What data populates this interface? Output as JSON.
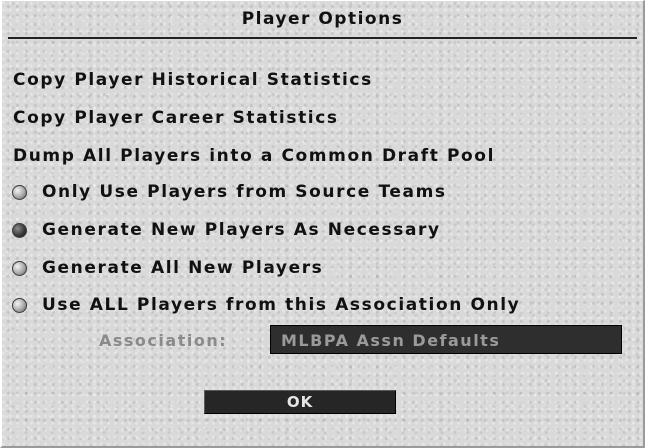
{
  "dialog": {
    "title": "Player Options"
  },
  "actions": [
    {
      "label": "Copy Player Historical Statistics"
    },
    {
      "label": "Copy Player Career Statistics"
    },
    {
      "label": "Dump All Players into a Common Draft Pool"
    }
  ],
  "options": [
    {
      "label": "Only Use Players from Source Teams",
      "selected": false
    },
    {
      "label": "Generate New Players As Necessary",
      "selected": true
    },
    {
      "label": "Generate All New Players",
      "selected": false
    },
    {
      "label": "Use ALL Players from this Association Only",
      "selected": false
    }
  ],
  "association": {
    "label": "Association:",
    "value": "MLBPA Assn Defaults"
  },
  "ok_label": "OK",
  "colors": {
    "background": "#d9d9d9",
    "text": "#111111",
    "disabled_text": "#8a8a8a",
    "field_background": "#2e2e2e",
    "button_background": "#262626"
  }
}
